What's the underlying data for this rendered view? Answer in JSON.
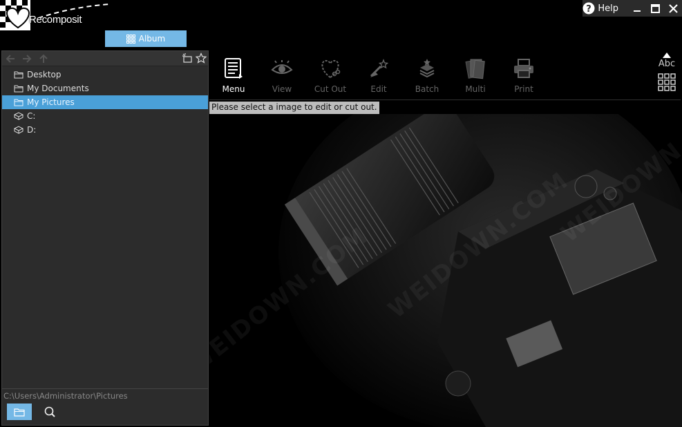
{
  "app": {
    "logo_text": "Recomposit"
  },
  "tabs": {
    "album_label": "Album"
  },
  "window": {
    "help_label": "Help"
  },
  "nav": {
    "tree": [
      {
        "label": "Desktop",
        "icon": "folder-icon",
        "selected": false
      },
      {
        "label": "My Documents",
        "icon": "folder-icon",
        "selected": false
      },
      {
        "label": "My Pictures",
        "icon": "folder-icon",
        "selected": true
      },
      {
        "label": "C:",
        "icon": "drive-icon",
        "selected": false
      },
      {
        "label": "D:",
        "icon": "drive-icon",
        "selected": false
      }
    ]
  },
  "path": {
    "current": "C:\\Users\\Administrator\\Pictures"
  },
  "toolbar": {
    "items": [
      {
        "label": "Menu",
        "icon": "menu-icon",
        "enabled": true
      },
      {
        "label": "View",
        "icon": "eye-icon",
        "enabled": false
      },
      {
        "label": "Cut Out",
        "icon": "heart-scissors-icon",
        "enabled": false
      },
      {
        "label": "Edit",
        "icon": "wand-icon",
        "enabled": false
      },
      {
        "label": "Batch",
        "icon": "stack-star-icon",
        "enabled": false
      },
      {
        "label": "Multi",
        "icon": "pages-icon",
        "enabled": false
      },
      {
        "label": "Print",
        "icon": "printer-icon",
        "enabled": false
      }
    ]
  },
  "view": {
    "text_toggle_label": "Abc"
  },
  "status": {
    "message": "Please select a image to edit or cut out."
  },
  "watermark": {
    "text": "WEIDOWN.COM"
  },
  "colors": {
    "accent": "#74b8e6",
    "selected": "#4aa0d8",
    "panel": "#2c2c2c"
  }
}
